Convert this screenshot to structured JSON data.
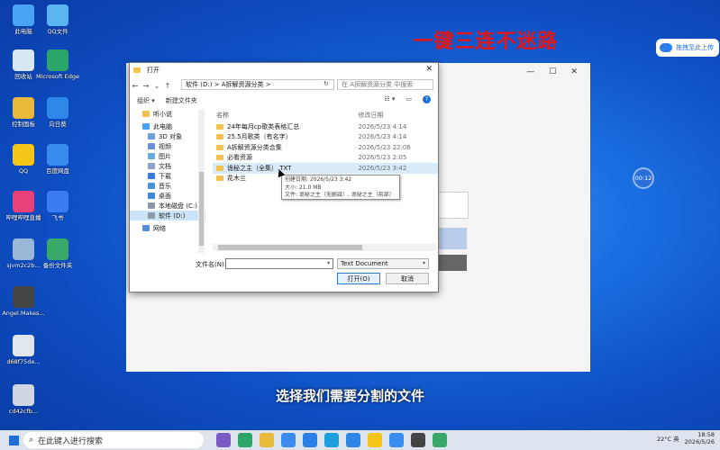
{
  "headline": "一键三连不迷路",
  "upload": {
    "label": "拖拽至此上传"
  },
  "clock_bubble": "00:12",
  "subtitle": "选择我们需要分割的文件",
  "desktop_icons": [
    {
      "label": "此电脑",
      "color": "#4aa3f5"
    },
    {
      "label": "QQ文件",
      "color": "#5bb5f0"
    },
    {
      "label": "回收站",
      "color": "#d8e6f4"
    },
    {
      "label": "Microsoft Edge",
      "color": "#2ba56a"
    },
    {
      "label": "控制面板",
      "color": "#e9b93a"
    },
    {
      "label": "向日葵",
      "color": "#2e86e8"
    },
    {
      "label": "QQ",
      "color": "#f5c518"
    },
    {
      "label": "百度网盘",
      "color": "#3a8bf0"
    },
    {
      "label": "哔哩哔哩直播",
      "color": "#e8417a"
    },
    {
      "label": "飞书",
      "color": "#3b7cf2"
    },
    {
      "label": "sjvm2c2b...",
      "color": "#9bb7d8"
    },
    {
      "label": "备份文件夹",
      "color": "#3aa868"
    },
    {
      "label": "Angel.Makes...",
      "color": "#444444"
    },
    {
      "label": "d68f75de...",
      "color": "#dfe6ee"
    },
    {
      "label": "cd42cfb...",
      "color": "#cfd8e2"
    }
  ],
  "bg_window": {
    "min": "—",
    "max": "☐",
    "close": "✕"
  },
  "dialog": {
    "title": "打开",
    "address": "软件 (D:) > A拆解资源分类 >",
    "search_placeholder": "在 A拆解资源分类 中搜索",
    "toolbar": {
      "organize": "组织 ▾",
      "new_folder": "新建文件夹"
    },
    "nav_items": [
      {
        "label": "听小说",
        "color": "#f2c14e"
      },
      {
        "label": "此电脑",
        "color": "#4aa3f5"
      },
      {
        "label": "3D 对象",
        "color": "#6aa0d8"
      },
      {
        "label": "视频",
        "color": "#6a8fd8"
      },
      {
        "label": "图片",
        "color": "#6aa8d8"
      },
      {
        "label": "文档",
        "color": "#8aa0c0"
      },
      {
        "label": "下载",
        "color": "#3a7ad8"
      },
      {
        "label": "音乐",
        "color": "#4a90d8"
      },
      {
        "label": "桌面",
        "color": "#3a8ad8"
      },
      {
        "label": "本地磁盘 (C:)",
        "color": "#8a9aaa"
      },
      {
        "label": "软件 (D:)",
        "color": "#8a9aaa"
      },
      {
        "label": "网络",
        "color": "#5a8ad8"
      }
    ],
    "headers": {
      "name": "名称",
      "date": "修改日期"
    },
    "files": [
      {
        "name": "24年每月cp歌类表格汇总",
        "date": "2026/5/23 4:14"
      },
      {
        "name": "25.5月歌类（有名字）",
        "date": "2026/5/23 4:14"
      },
      {
        "name": "A拆解资源分类合集",
        "date": "2026/5/23 22:06"
      },
      {
        "name": "必看资源",
        "date": "2026/5/23 2:05"
      },
      {
        "name": "诡秘之主（全集）.TXT",
        "date": "2026/5/23 3:42"
      },
      {
        "name": "花木兰",
        "date": ""
      }
    ],
    "tooltip": [
      "创建日期: 2026/5/23 3:42",
      "大小: 21.0 MB",
      "文件: 诡秘之主（无删减）, 诡秘之主（前部）"
    ],
    "filename_label": "文件名(N):",
    "filename_value": "",
    "file_type": "Text Document",
    "open_label": "打开(O)",
    "cancel_label": "取消"
  },
  "taskbar": {
    "search": "在此键入进行搜索",
    "apps": [
      "#7a5cc7",
      "#2ba56a",
      "#e9b93a",
      "#3a8bf0",
      "#2b7fe8",
      "#1ea0e0",
      "#2e86e8",
      "#f5c518",
      "#3a8bf0",
      "#444444",
      "#3aa868"
    ],
    "tray": "22°C  英",
    "time": "18:58",
    "date": "2026/5/26"
  }
}
